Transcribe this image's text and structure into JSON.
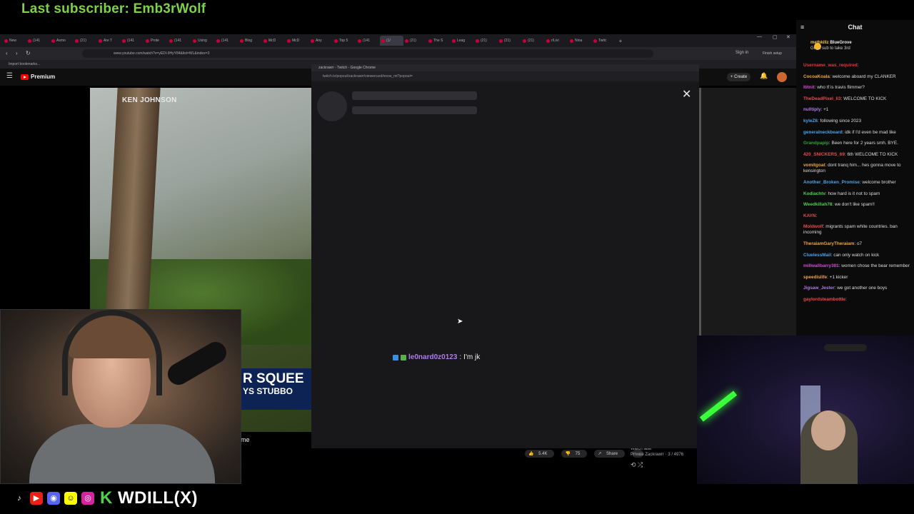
{
  "overlay": {
    "last_subscriber": "Last subscriber: Emb3rWolf"
  },
  "browser": {
    "tabs": [
      "New",
      "(141",
      "Asmo",
      "(21)",
      "Are T",
      "(141",
      "Prote",
      "(141",
      "Using",
      "(141",
      "Blog",
      "McD",
      "McD",
      "Any",
      "Top 5",
      "(141",
      "(1/",
      "(21)",
      "The S",
      "Leag",
      "(21)",
      "(21)",
      "(21)",
      "r/Livi",
      "Nina",
      "Twitc"
    ],
    "url": "www.youtube.com/watch?v=yEDI-9HyY84&list=WL&index=3",
    "bookmarks": "Import bookmarks...",
    "profile_label": "Sign in",
    "finish_setup": "Finish setup"
  },
  "youtube": {
    "logo_label": "Premium",
    "create_label": "Create",
    "reporter_name": "KEN JOHNSON",
    "lower_third_line1": "R SQUEE",
    "lower_third_line2": "YS STUBBO",
    "title_fragment": "me",
    "likes": "5.4K",
    "dislikes": "75",
    "share": "Share",
    "watch_later": "Watch later",
    "watch_later_sub": "Private Zackrawrr · 3 / 4976"
  },
  "popout": {
    "window_title": "zackrawrr - Twitch - Google Chrome",
    "url": "twitch.tv/popout/zackrawrr/viewercard/snow_mt?popout=",
    "chat_username": "le0nard0z0123",
    "chat_sep": ":",
    "chat_message": "I'm jk"
  },
  "chat": {
    "title": "Chat",
    "pinned_user1": "methkillz",
    "pinned_user2": "BlueGrove",
    "pinned_text": "Gift 1 sub to take 3rd",
    "messages": [
      {
        "user": "Username_was_required",
        "color": "#e03a3a",
        "text": ""
      },
      {
        "user": "CocoaKoala",
        "color": "#f0a53a",
        "text": "welcome aboard my CLANKER"
      },
      {
        "user": "Ititnit",
        "color": "#d24bd2",
        "text": "who tf is travis flimmer?"
      },
      {
        "user": "TheDeadPixel_li3",
        "color": "#e84b4b",
        "text": "WELCOME TO KICK"
      },
      {
        "user": "nulltiply",
        "color": "#b07ce8",
        "text": "+1"
      },
      {
        "user": "kyleZ6",
        "color": "#4ba3e8",
        "text": "following since 2023"
      },
      {
        "user": "generalneckbeard",
        "color": "#4ba3e8",
        "text": "idk if I'd even be mad like"
      },
      {
        "user": "Grandpapip",
        "color": "#3a9f3a",
        "text": "Been here for 2 years smh. BYE."
      },
      {
        "user": "420_SNICKERS_69",
        "color": "#e84b4b",
        "text": "6th WELCOME TO KICK"
      },
      {
        "user": "vomitgoat",
        "color": "#f0a53a",
        "text": "dont tranq him... hes gonna move to kensington"
      },
      {
        "user": "Another_Broken_Promise",
        "color": "#4ba3e8",
        "text": "welcome brother"
      },
      {
        "user": "Kodiachtv",
        "color": "#4bd24b",
        "text": "how hard is it not to spam"
      },
      {
        "user": "Weedkillah78",
        "color": "#4bd24b",
        "text": "we don't like spam!!"
      },
      {
        "user": "KAYN",
        "color": "#e84b4b",
        "text": ""
      },
      {
        "user": "Moldwolf",
        "color": "#e84b4b",
        "text": "migrants spam white countries. ban incoming"
      },
      {
        "user": "TheraiamGaryTheraiam",
        "color": "#f0a53a",
        "text": "o7"
      },
      {
        "user": "CluelessMail",
        "color": "#4ba3e8",
        "text": "can only watch on kick"
      },
      {
        "user": "millwallbarry301",
        "color": "#d24bd2",
        "text": "women chose the bear remember"
      },
      {
        "user": "speedislife",
        "color": "#f0a53a",
        "text": "+1 kicker"
      },
      {
        "user": "Jigsaw_Jester",
        "color": "#b07ce8",
        "text": "we got another one boys"
      },
      {
        "user": "gaylordsteambottle",
        "color": "#e84b4b",
        "text": ""
      }
    ]
  },
  "social": {
    "handle_prefix": "K",
    "handle": "WDILL(X)"
  }
}
